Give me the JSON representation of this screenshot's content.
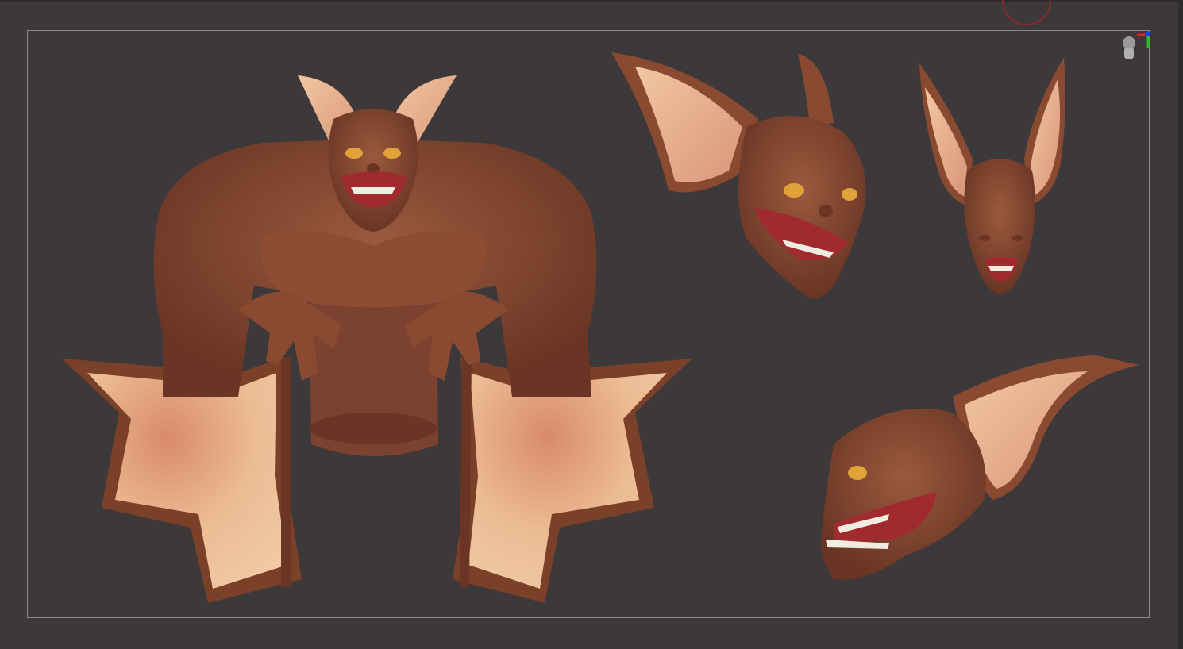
{
  "viewport": {
    "background": "#3d393a",
    "frame_border": "#8c8889"
  },
  "model": {
    "skin": "#8a4a32",
    "skin_dark": "#6a3524",
    "membrane": "#e9b48c",
    "membrane_shadow": "#d4896a",
    "mouth": "#a12a2e",
    "eye": "#e2a23a",
    "teeth": "#f1ece0"
  },
  "views": [
    "front-full-body",
    "three-quarter-head",
    "front-head",
    "side-head"
  ],
  "gizmo": {
    "icon": "navigation-gizmo-icon",
    "axis_colors": [
      "#e02020",
      "#20c020",
      "#2040e0"
    ]
  },
  "rotation_indicator": {
    "icon": "rotation-ring-icon",
    "color": "#8a2a2a"
  }
}
